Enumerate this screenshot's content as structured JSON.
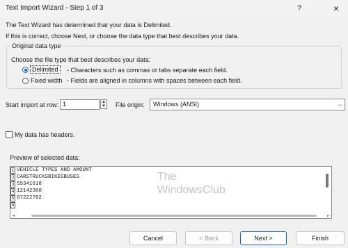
{
  "window": {
    "title": "Text Import Wizard - Step 1 of 3",
    "help": "?",
    "close": "×"
  },
  "intro": {
    "line1": "The Text Wizard has determined that your data is Delimited.",
    "line2": "If this is correct, choose Next, or choose the data type that best describes your data."
  },
  "datatype": {
    "group_label": "Original data type",
    "prompt": "Choose the file type that best describes your data:",
    "options": [
      {
        "label": "Delimited",
        "desc": "- Characters such as commas or tabs separate each field.",
        "selected": true
      },
      {
        "label": "Fixed width",
        "desc": "- Fields are aligned in columns with spaces between each field.",
        "selected": false
      }
    ]
  },
  "start_import": {
    "label": "Start import at row:",
    "value": "1"
  },
  "file_origin": {
    "label": "File origin:",
    "value": "Windows (ANSI)"
  },
  "headers": {
    "label": "My data has headers.",
    "checked": false
  },
  "preview": {
    "label": "Preview of selected data:",
    "rows": [
      {
        "num": "1",
        "text": "VEHICLE TYPES AND AMOUNT"
      },
      {
        "num": "2",
        "text": "CARSTRUCKSBIKESBUSES"
      },
      {
        "num": "3",
        "text": "55341618"
      },
      {
        "num": "4",
        "text": "12142388"
      },
      {
        "num": "5",
        "text": "67222782"
      },
      {
        "num": "6",
        "text": ""
      }
    ]
  },
  "watermark": {
    "line1": "The",
    "line2": "WindowsClub"
  },
  "buttons": {
    "cancel": "Cancel",
    "back": "< Back",
    "next": "Next >",
    "finish": "Finish"
  },
  "colors": {
    "accent": "#1a5fb4",
    "background": "#f0f0f0"
  }
}
